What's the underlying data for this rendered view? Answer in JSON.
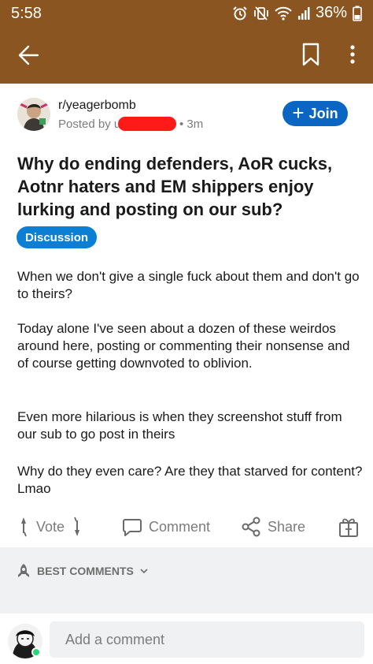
{
  "status_bar": {
    "time": "5:58",
    "battery": "36%",
    "icons": [
      "alarm-icon",
      "vibrate-mute-icon",
      "wifi-icon",
      "signal-icon",
      "battery-icon"
    ]
  },
  "nav": {
    "icons": [
      "back-arrow-icon",
      "bookmark-icon",
      "more-vertical-icon"
    ]
  },
  "post": {
    "subreddit": "r/yeagerbomb",
    "posted_by_prefix": "Posted by u",
    "time_ago": "• 3m",
    "join_label": "Join",
    "title": "Why do ending defenders, AoR cucks, Aotnr haters and EM shippers enjoy lurking and posting on our sub?",
    "flair": "Discussion",
    "paragraphs": [
      "When we don't give a single fuck about them and don't go to theirs?",
      "Today alone I've seen about a dozen of these weirdos around here, posting or commenting their nonsense and of course getting downvoted to oblivion.",
      "Even more hilarious is when they screenshot stuff from our sub to go post in theirs",
      "Why do they even care? Are they that starved for content? Lmao"
    ]
  },
  "actions": {
    "vote_label": "Vote",
    "comment_label": "Comment",
    "share_label": "Share"
  },
  "comments": {
    "sort_label": "BEST COMMENTS",
    "input_placeholder": "Add a comment"
  },
  "colors": {
    "header_bg": "#8a5520",
    "join_bg": "#0a66c2",
    "flair_bg": "#0a7fd4",
    "online": "#2bd67b"
  }
}
